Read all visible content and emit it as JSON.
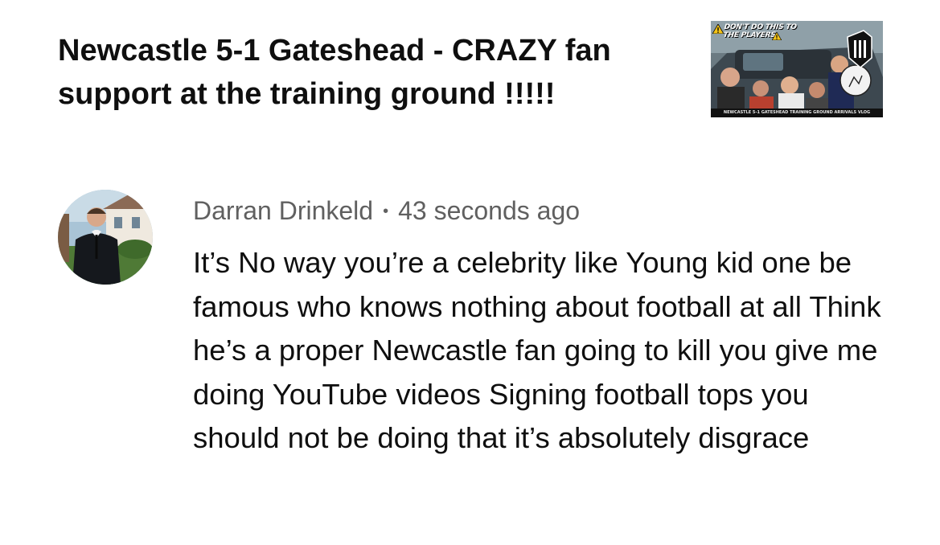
{
  "video": {
    "title": "Newcastle 5-1 Gateshead - CRAZY fan support at the training ground !!!!!",
    "thumbnail": {
      "overlay_text": "DON'T DO THIS TO\nTHE PLAYERS",
      "caption": "NEWCASTLE 5-1 GATESHEAD TRAINING GROUND ARRIVALS VLOG",
      "badge_icons": [
        "warning-icon",
        "warning-icon"
      ],
      "crest_icon": "newcastle-crest-icon"
    }
  },
  "comment": {
    "author": "Darran Drinkeld",
    "separator": "•",
    "timestamp": "43 seconds ago",
    "text": "It’s No way you’re a celebrity like Young kid one be famous who knows nothing about football at all Think he’s a proper Newcastle fan going to kill you give me doing YouTube videos Signing football tops you should not be doing that it’s absolutely disgrace",
    "avatar_icon": "user-avatar-photo"
  },
  "colors": {
    "title_text": "#0f0f0f",
    "meta_text": "#606060",
    "background": "#ffffff",
    "warning_yellow": "#f5c518"
  }
}
